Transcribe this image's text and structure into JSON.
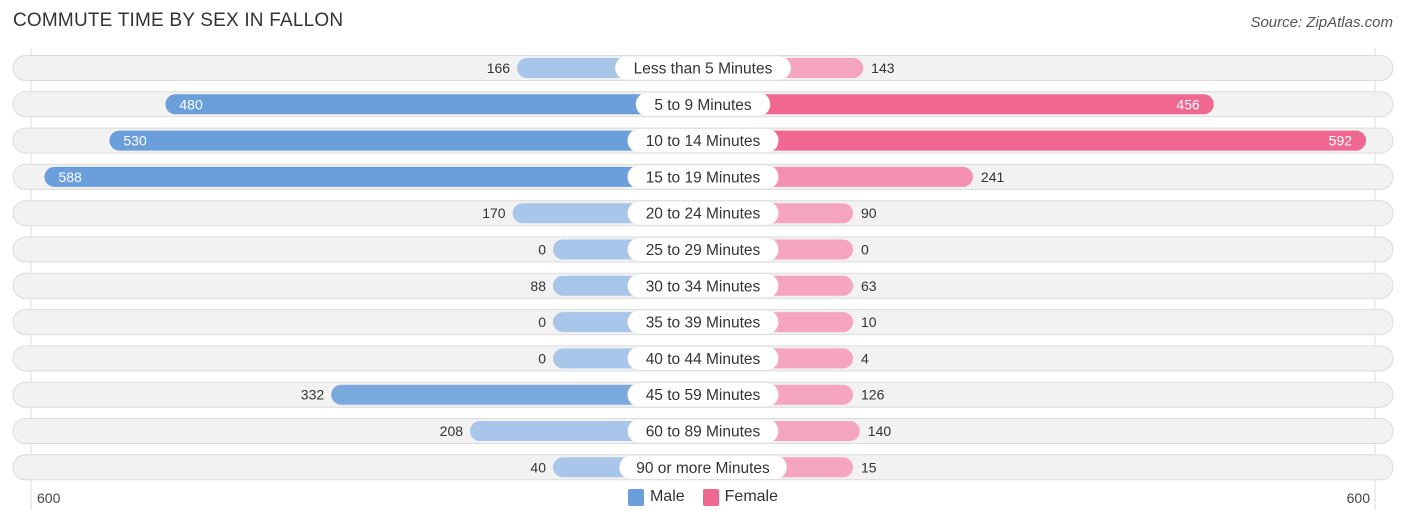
{
  "header": {
    "title": "COMMUTE TIME BY SEX IN FALLON",
    "source": "Source: ZipAtlas.com"
  },
  "legend": {
    "male_label": "Male",
    "female_label": "Female"
  },
  "axis": {
    "left_label": "600",
    "right_label": "600"
  },
  "colors": {
    "male": "#6a9fdb",
    "male_light": "#a7c6ea",
    "female": "#f06792",
    "female_light": "#f5a5bf",
    "track": "#f2f2f2"
  },
  "chart_data": {
    "type": "bar",
    "orientation": "horizontal-diverging",
    "title": "COMMUTE TIME BY SEX IN FALLON",
    "categories": [
      "Less than 5 Minutes",
      "5 to 9 Minutes",
      "10 to 14 Minutes",
      "15 to 19 Minutes",
      "20 to 24 Minutes",
      "25 to 29 Minutes",
      "30 to 34 Minutes",
      "35 to 39 Minutes",
      "40 to 44 Minutes",
      "45 to 59 Minutes",
      "60 to 89 Minutes",
      "90 or more Minutes"
    ],
    "series": [
      {
        "name": "Male",
        "values": [
          166,
          480,
          530,
          588,
          170,
          0,
          88,
          0,
          0,
          332,
          208,
          40
        ]
      },
      {
        "name": "Female",
        "values": [
          143,
          456,
          592,
          241,
          90,
          0,
          63,
          10,
          4,
          126,
          140,
          15
        ]
      }
    ],
    "xlim": [
      -600,
      600
    ],
    "legend_position": "bottom-center"
  }
}
